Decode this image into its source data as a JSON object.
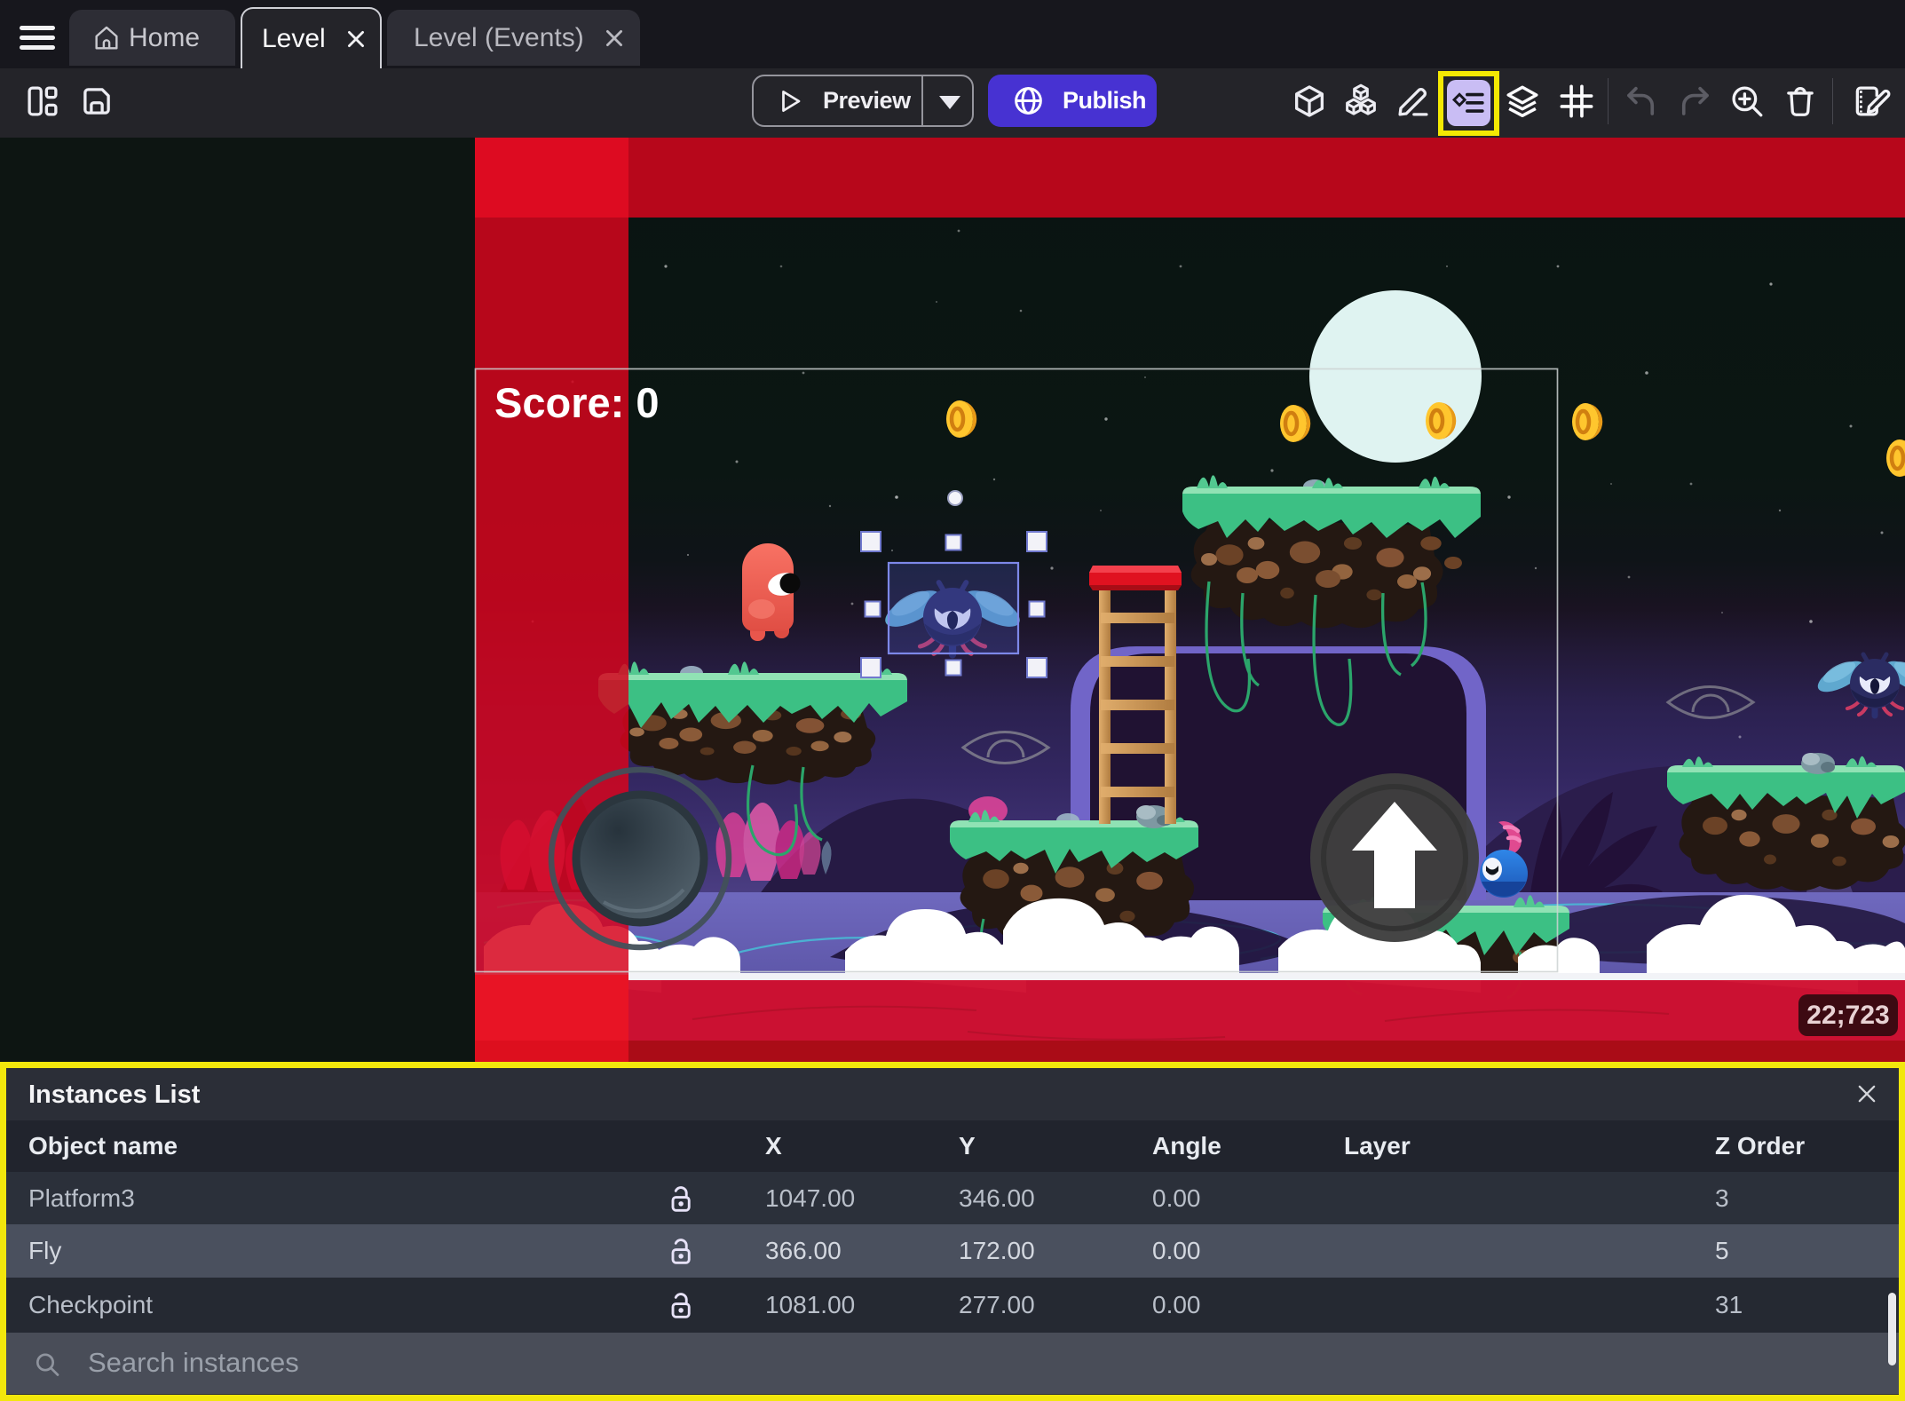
{
  "window": {
    "tabs": [
      {
        "label": "Home"
      },
      {
        "label": "Level",
        "active": true
      },
      {
        "label": "Level (Events)"
      }
    ]
  },
  "toolbar": {
    "preview_label": "Preview",
    "publish_label": "Publish",
    "icons": [
      "project-manager",
      "save",
      "objects",
      "object-groups",
      "edit",
      "instances-list",
      "layers",
      "grid",
      "undo",
      "redo",
      "zoom-in",
      "delete",
      "edit-scene-properties"
    ],
    "highlighted_icon": "instances-list",
    "highlight_color": "#f4e903",
    "publish_color": "#4732d2"
  },
  "scene": {
    "hud": {
      "score_label": "Score: 0"
    },
    "status_coords": "22;723",
    "selected_instance": "Fly",
    "background_color": "#e2001a"
  },
  "instances_panel": {
    "title": "Instances List",
    "columns": [
      "Object name",
      "X",
      "Y",
      "Angle",
      "Layer",
      "Z Order"
    ],
    "rows": [
      {
        "name": "Platform3",
        "x": "1047.00",
        "y": "346.00",
        "angle": "0.00",
        "layer": "",
        "z": "3"
      },
      {
        "name": "Fly",
        "x": "366.00",
        "y": "172.00",
        "angle": "0.00",
        "layer": "",
        "z": "5"
      },
      {
        "name": "Checkpoint",
        "x": "1081.00",
        "y": "277.00",
        "angle": "0.00",
        "layer": "",
        "z": "31"
      }
    ],
    "search_placeholder": "Search instances"
  }
}
